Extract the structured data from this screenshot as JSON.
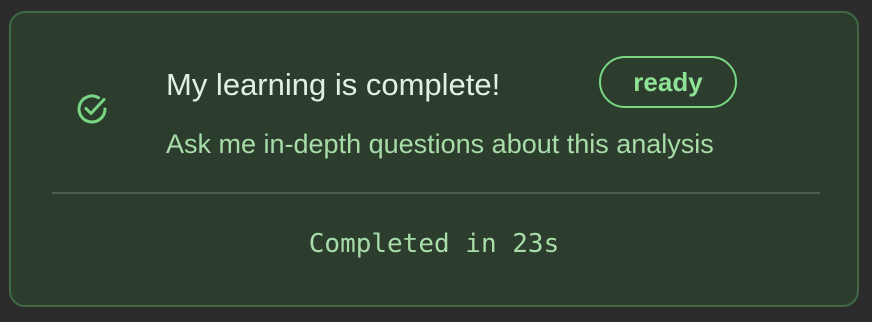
{
  "status_card": {
    "icon": "check-circle-icon",
    "title": "My learning is complete!",
    "badge": "ready",
    "subtitle": "Ask me in-depth questions about this analysis",
    "footer": "Completed in 23s"
  },
  "colors": {
    "accent": "#79d683",
    "card_background": "#2c3d2e",
    "card_border": "#3f6a45",
    "text_primary": "#e4efe4",
    "text_secondary": "#a8dca8"
  }
}
